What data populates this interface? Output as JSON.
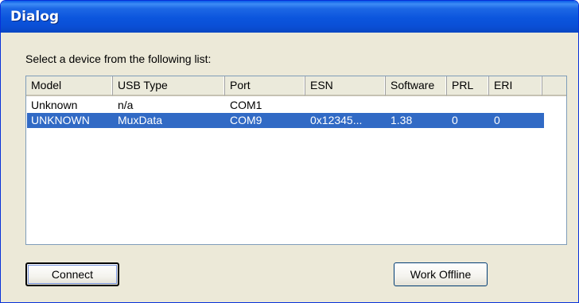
{
  "window": {
    "title": "Dialog"
  },
  "prompt": "Select a device from the following list:",
  "table": {
    "columns": [
      "Model",
      "USB Type",
      "Port",
      "ESN",
      "Software",
      "PRL",
      "ERI"
    ],
    "rows": [
      {
        "cells": [
          "Unknown",
          "n/a",
          "COM1",
          "",
          "",
          "",
          ""
        ],
        "selected": false
      },
      {
        "cells": [
          "UNKNOWN",
          "MuxData",
          "COM9",
          "0x12345...",
          "1.38",
          "0",
          "0"
        ],
        "selected": true
      }
    ]
  },
  "buttons": {
    "connect": "Connect",
    "work_offline": "Work Offline"
  },
  "colors": {
    "title_bar": "#0a55dd",
    "dialog_bg": "#ece9d8",
    "selection": "#316ac5"
  }
}
